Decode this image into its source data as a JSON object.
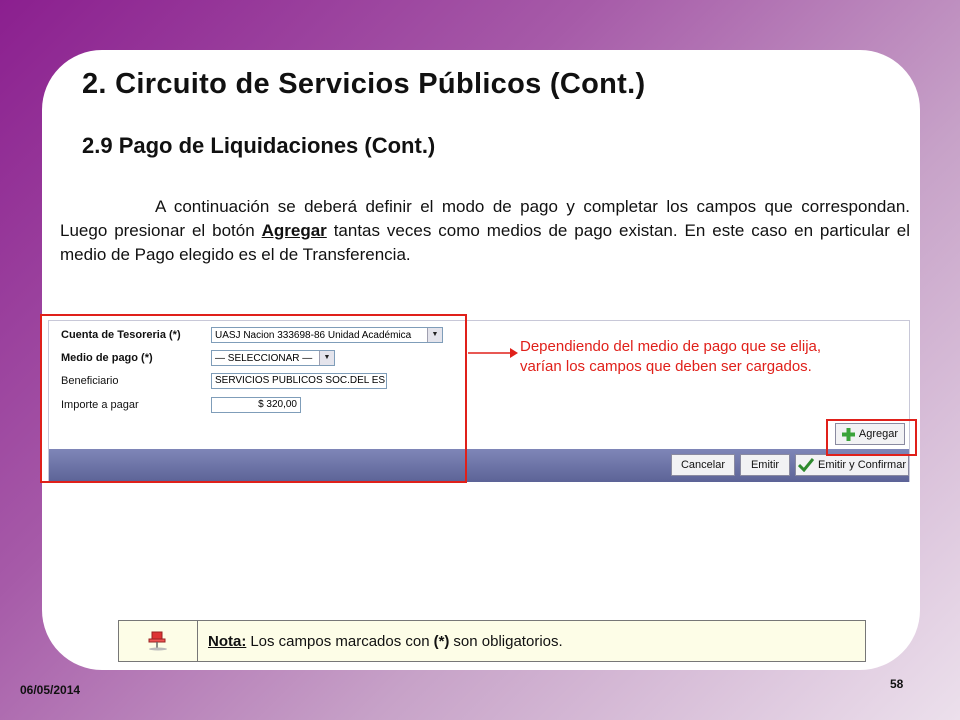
{
  "title": "2. Circuito de Servicios Públicos (Cont.)",
  "subtitle": "2.9 Pago de Liquidaciones (Cont.)",
  "paragraph": {
    "part1": "A continuación se deberá definir el modo de pago y completar los campos que correspondan. Luego presionar el botón ",
    "keyword": "Agregar",
    "part2": " tantas veces como medios de pago existan. En este caso en particular el medio de Pago elegido es el de Transferencia."
  },
  "form": {
    "fields": [
      {
        "label": "Cuenta de Tesoreria (*)",
        "value": "UASJ Nacion 333698-86 Unidad Académica"
      },
      {
        "label": "Medio de pago (*)",
        "value": "— SELECCIONAR —"
      },
      {
        "label": "Beneficiario",
        "value": "SERVICIOS PUBLICOS SOC.DEL ES"
      },
      {
        "label": "Importe a pagar",
        "value": "$ 320,00"
      }
    ],
    "buttons": {
      "agregar": "Agregar",
      "cancelar": "Cancelar",
      "emitir": "Emitir",
      "emitir_confirmar": "Emitir y Confirmar"
    }
  },
  "annotation": "Dependiendo del medio de pago que se elija, varían los campos que deben ser cargados.",
  "note": {
    "label": "Nota:",
    "text_before": "Los campos marcados con",
    "asterisk": "(*)",
    "text_after": "son obligatorios."
  },
  "footer": {
    "date": "06/05/2014",
    "page": "58"
  },
  "colors": {
    "highlight": "#e0201a",
    "form_bar": "#6a71a6",
    "note_bg": "#fdfde7"
  },
  "icons": {
    "agregar": "plus-icon",
    "emitir_confirmar": "checkmark-icon",
    "note": "pushpin-icon"
  }
}
